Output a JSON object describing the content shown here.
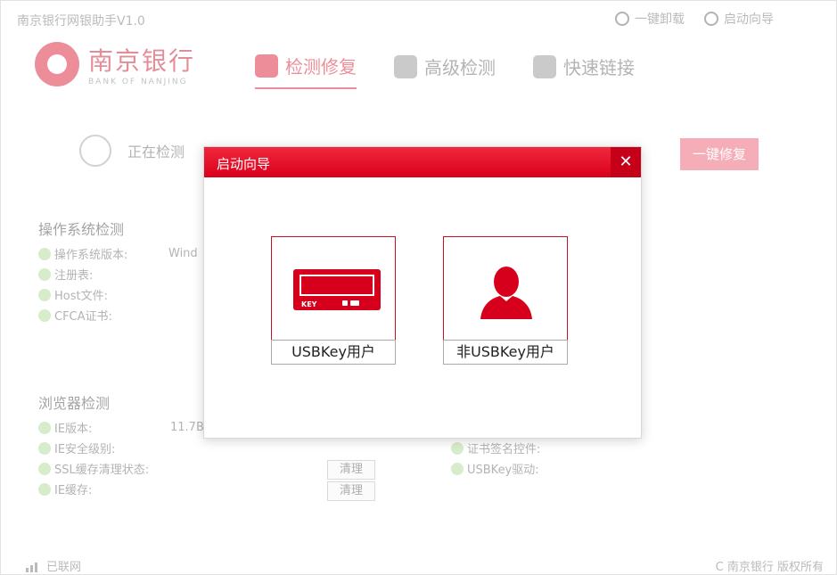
{
  "app": {
    "title": "南京银行网银助手V1.0"
  },
  "top_links": [
    {
      "label": "一键卸载"
    },
    {
      "label": "启动向导"
    }
  ],
  "logo": {
    "cn": "南京银行",
    "en": "BANK OF NANJING"
  },
  "nav": [
    {
      "label": "检测修复",
      "active": true
    },
    {
      "label": "高级检测",
      "active": false
    },
    {
      "label": "快速链接",
      "active": false
    }
  ],
  "scan": {
    "status": "正在检测"
  },
  "oneclick": {
    "label": "一键修复"
  },
  "os_section": {
    "title": "操作系统检测",
    "items": [
      {
        "label": "操作系统版本:",
        "value": "Wind"
      },
      {
        "label": "注册表:",
        "value": ""
      },
      {
        "label": "Host文件:",
        "value": ""
      },
      {
        "label": "CFCA证书:",
        "value": ""
      }
    ]
  },
  "browser_section": {
    "title": "浏览器检测",
    "items": [
      {
        "label": "IE版本:",
        "value": "11.7B"
      },
      {
        "label": "IE安全级别:",
        "value": ""
      },
      {
        "label": "SSL缓存清理状态:",
        "value": ""
      },
      {
        "label": "IE缓存:",
        "value": ""
      }
    ],
    "clean_label": "清理",
    "right_items": [
      {
        "label": "证书签名控件:"
      },
      {
        "label": "USBKey驱动:"
      }
    ]
  },
  "footer": {
    "network": "已联网",
    "copyright": "C 南京银行 版权所有"
  },
  "modal": {
    "title": "启动向导",
    "close": "✕",
    "options": [
      {
        "label": "USBKey用户",
        "key_text": "KEY"
      },
      {
        "label": "非USBKey用户"
      }
    ]
  },
  "colors": {
    "brand_red": "#d6001c",
    "check_green": "#a6d48a"
  }
}
